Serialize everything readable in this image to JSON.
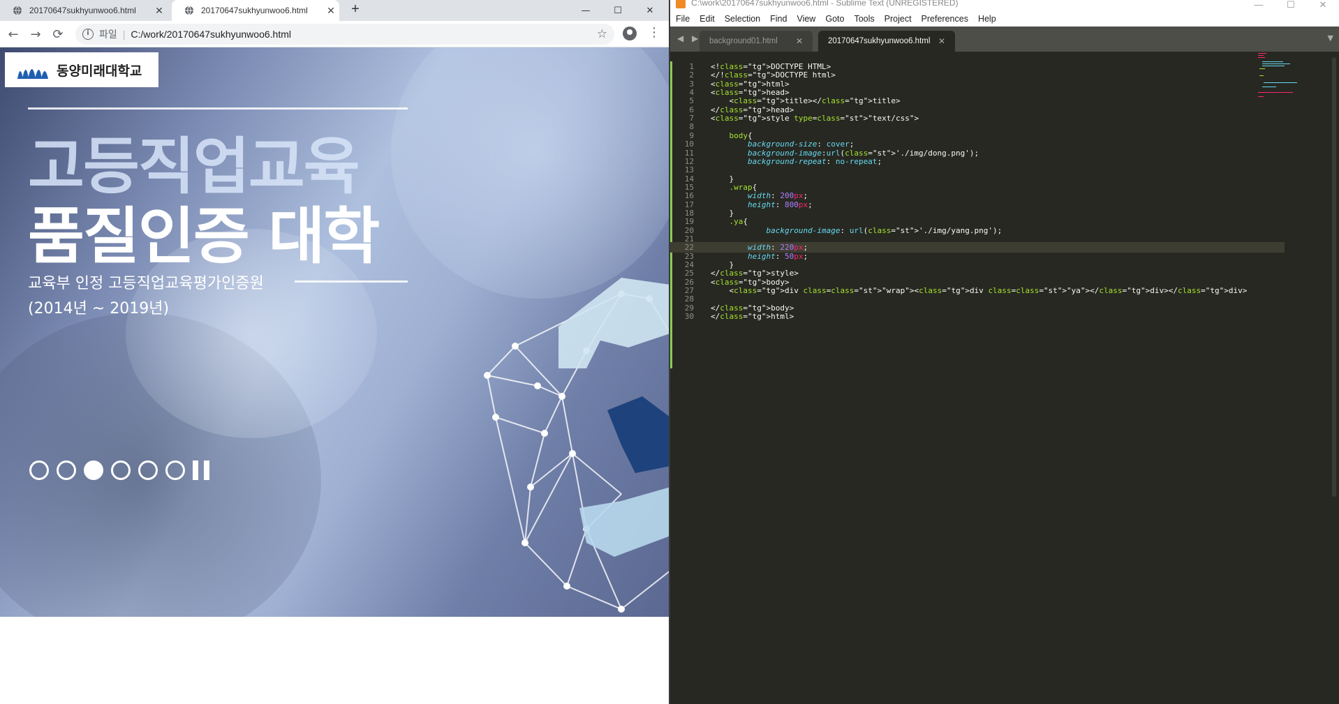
{
  "chrome": {
    "tabs": [
      {
        "title": "20170647sukhyunwoo6.html",
        "close": "✕"
      },
      {
        "title": "20170647sukhyunwoo6.html",
        "close": "✕"
      }
    ],
    "new_tab": "+",
    "window": {
      "minimize": "—",
      "maximize": "☐",
      "close": "✕"
    },
    "nav": {
      "back": "←",
      "forward": "→",
      "reload": "⟳"
    },
    "address": {
      "info": "i",
      "scheme": "파일",
      "separator": "|",
      "url": "C:/work/20170647sukhyunwoo6.html",
      "star": "☆"
    },
    "menu": "⋮",
    "page": {
      "logo_text": "동양미래대학교",
      "headline_line1": "고등직업교육",
      "headline_line2": "품질인증 대학",
      "subline1": "교육부 인정 고등직업교육평가인증원",
      "subline2": "(2014년 ~ 2019년)",
      "slide_count": 6,
      "active_slide": 3
    }
  },
  "sublime": {
    "title": "C:\\work\\20170647sukhyunwoo6.html - Sublime Text (UNREGISTERED)",
    "window": {
      "minimize": "—",
      "maximize": "☐",
      "close": "✕"
    },
    "menu": [
      "File",
      "Edit",
      "Selection",
      "Find",
      "View",
      "Goto",
      "Tools",
      "Project",
      "Preferences",
      "Help"
    ],
    "tab_arrows": "◀ ▶",
    "tabs": [
      {
        "title": "background01.html",
        "close": "✕"
      },
      {
        "title": "20170647sukhyunwoo6.html",
        "close": "✕"
      }
    ],
    "tab_dropdown": "▼",
    "current_line": 22,
    "code_lines": [
      "<!DOCTYPE HTML>",
      "</!DOCTYPE html>",
      "<html>",
      "<head>",
      "    <title></title>",
      "</head>",
      "<style type=\"text/css\">",
      "",
      "    body{",
      "        background-size: cover;",
      "        background-image:url('./img/dong.png');",
      "        background-repeat: no-repeat;",
      "",
      "    }",
      "    .wrap{",
      "        width: 200px;",
      "        height: 800px;",
      "    }",
      "    .ya{",
      "            background-image: url('./img/yang.png');",
      "",
      "        width: 220px;",
      "        height: 50px;",
      "    }",
      "</style>",
      "<body>",
      "    <div class=\"wrap\"><div class=\"ya\"></div></div>",
      "",
      "</body>",
      "</html>"
    ]
  }
}
